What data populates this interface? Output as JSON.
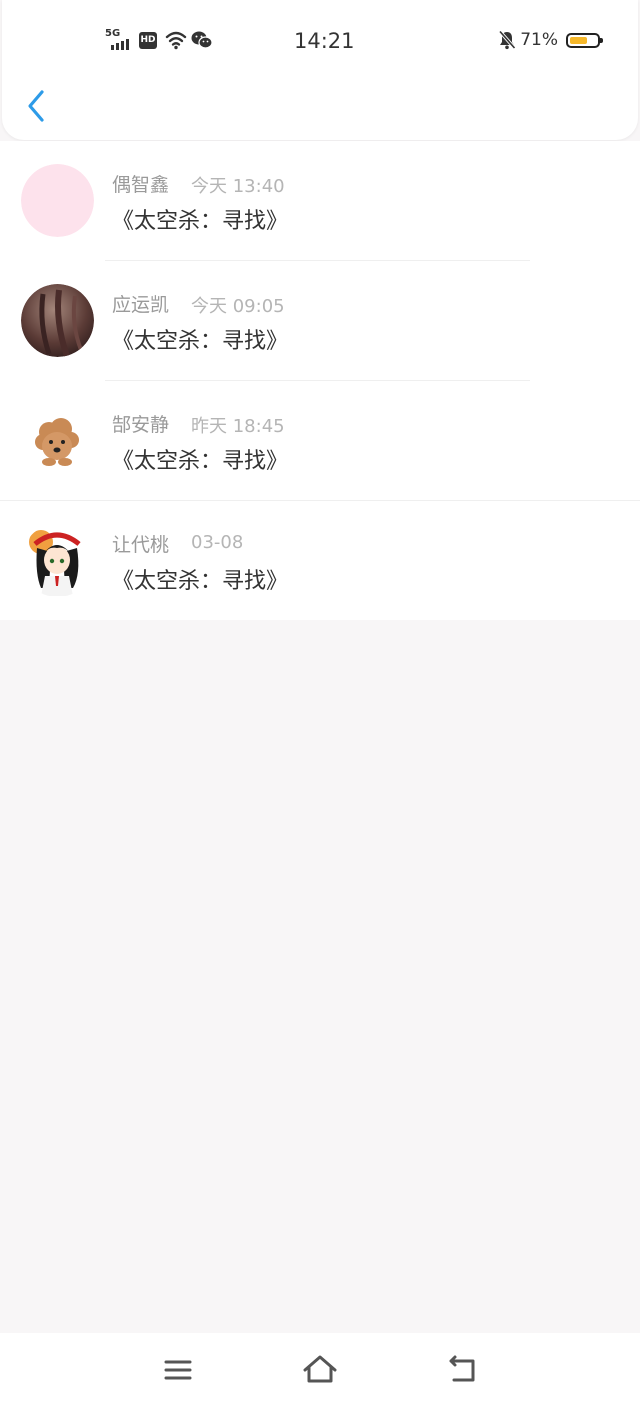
{
  "status_bar": {
    "network_label": "5G",
    "hd_label": "HD",
    "time": "14:21",
    "battery_text": "71%",
    "battery_level": 0.71,
    "battery_color": "#f6b82a",
    "icons": [
      "signal-icon",
      "hd-icon",
      "wifi-icon",
      "wechat-icon",
      "bell-off-icon",
      "battery-icon"
    ]
  },
  "header": {
    "back_icon": "chevron-left-icon",
    "accent_color": "#2d9be8"
  },
  "list": {
    "items": [
      {
        "name": "偶智鑫",
        "time": "今天 13:40",
        "message": "《太空杀：寻找》",
        "avatar": "pink-circle"
      },
      {
        "name": "应运凯",
        "time": "今天 09:05",
        "message": "《太空杀：寻找》",
        "avatar": "photo-hair"
      },
      {
        "name": "郜安静",
        "time": "昨天 18:45",
        "message": "《太空杀：寻找》",
        "avatar": "cartoon-dog"
      },
      {
        "name": "让代桃",
        "time": "03-08",
        "message": "《太空杀：寻找》",
        "avatar": "anime-girl"
      }
    ]
  },
  "nav_bar": {
    "icons": [
      "menu-icon",
      "home-icon",
      "back-icon"
    ]
  }
}
